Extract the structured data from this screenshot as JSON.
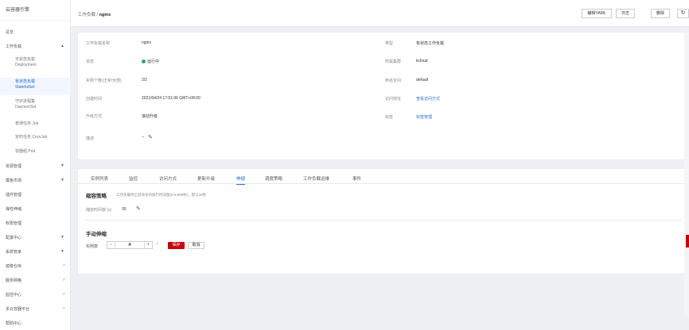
{
  "sidebar": {
    "title": "云容器引擎",
    "overview": "总览",
    "workloads": "工作负载",
    "sub_items": [
      {
        "line1": "无状态负载",
        "line2": "Deployment"
      },
      {
        "line1": "有状态负载",
        "line2": "StatefulSet"
      },
      {
        "line1": "守护进程集",
        "line2": "DaemonSet"
      },
      {
        "line1": "普通任务 Job",
        "line2": ""
      },
      {
        "line1": "定时任务 CronJob",
        "line2": ""
      },
      {
        "line1": "容器组 Pod",
        "line2": ""
      }
    ],
    "items": [
      "资源管理",
      "模板市场",
      "插件管理",
      "弹性伸缩",
      "权限管理",
      "配置中心",
      "系统管家",
      "镜像仓库",
      "服务网格",
      "监控中心",
      "多云容器平台",
      "帮助中心"
    ]
  },
  "header": {
    "breadcrumb_parent": "工作负载",
    "breadcrumb_sep": "/",
    "breadcrumb_current": "nginx",
    "edit_yaml": "编辑YAML",
    "log": "日志",
    "delete": "删除",
    "refresh_icon": "refresh-icon"
  },
  "info": {
    "name_label": "工作负载名称",
    "name_value": "nginx",
    "status_label": "状态",
    "status_value": "运行中",
    "instances_label": "实例个数(正常/全部)",
    "instances_value": "2/2",
    "created_label": "创建时间",
    "created_value": "2021/04/24 17:51:06 GMT+08:00",
    "upgrade_label": "升级方式",
    "upgrade_value": "滚动升级",
    "desc_label": "描述",
    "desc_value": "--",
    "type_label": "类型",
    "type_value": "有状态工作负载",
    "cluster_label": "所属集群",
    "cluster_value": "kcloud",
    "namespace_label": "命名空间",
    "namespace_value": "default",
    "access_label": "访问地址",
    "access_value": "查看访问方式",
    "tags_label": "标签",
    "tags_value": "标签管理"
  },
  "tabs": [
    "实例列表",
    "监控",
    "访问方式",
    "更新升级",
    "伸缩",
    "调度策略",
    "工作负载运维",
    "事件"
  ],
  "active_tab": 4,
  "scaling": {
    "policy_title": "缩容策略",
    "policy_hint": "工作负载停止前命令的执行时间窗(0-9,999秒)，默认30秒",
    "timewindow_label": "缩容时间窗 (s)",
    "timewindow_value": "30",
    "manual_title": "手动伸缩",
    "instances_label": "实例数",
    "instances_value": "4",
    "minus": "−",
    "plus": "+",
    "up_arrow": "↑",
    "save": "保存",
    "cancel": "取消"
  },
  "colors": {
    "accent": "#c7000b",
    "link": "#2d6fd6",
    "running": "#35a35f"
  }
}
